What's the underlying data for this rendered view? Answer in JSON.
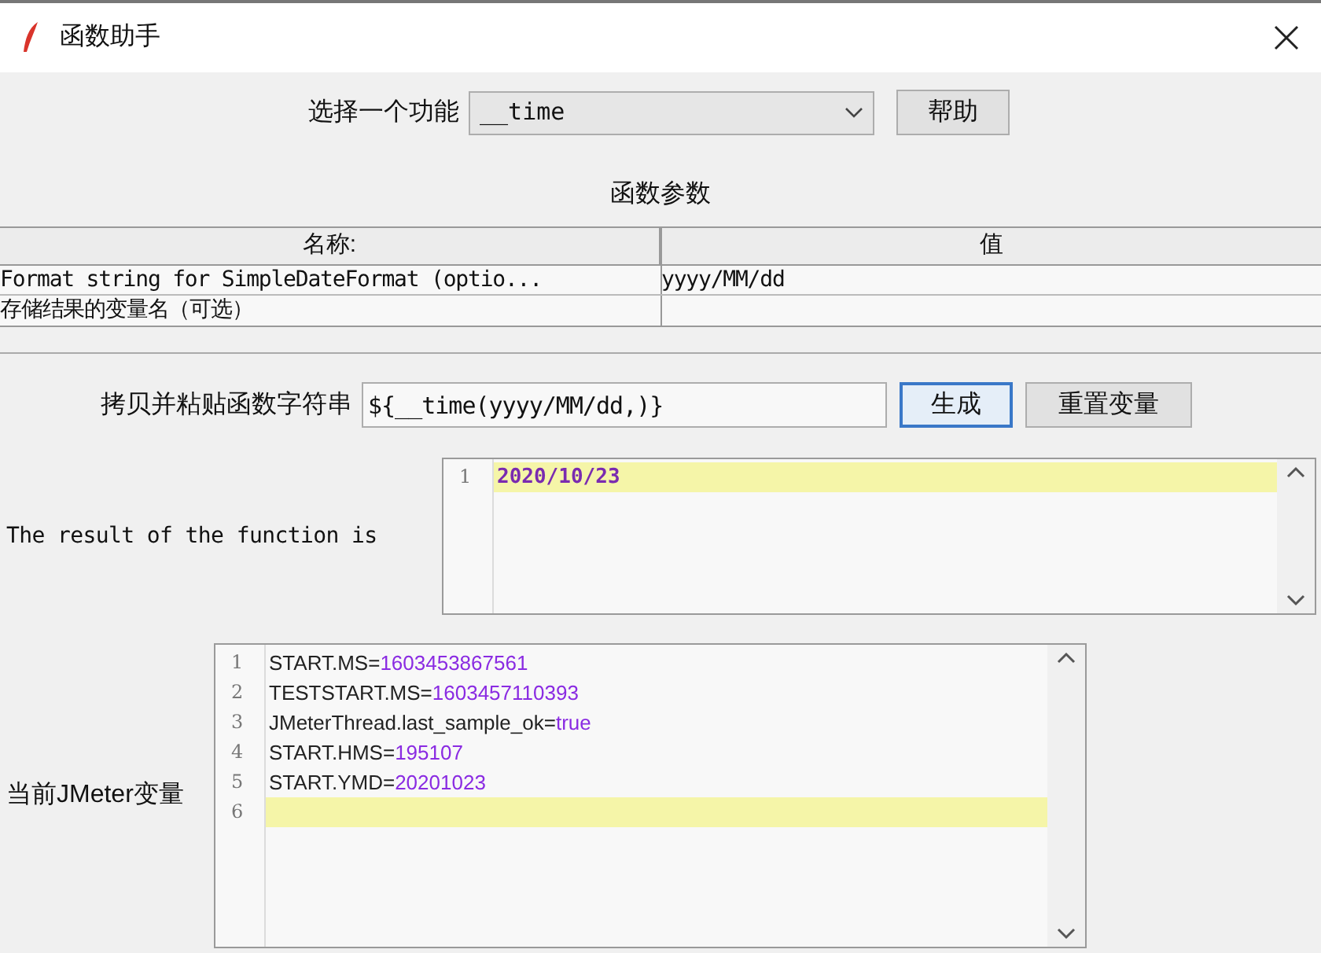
{
  "window": {
    "title": "函数助手"
  },
  "function_select": {
    "label": "选择一个功能",
    "value": "__time"
  },
  "help_button": "帮助",
  "params_title": "函数参数",
  "table": {
    "columns": [
      "名称:",
      "值"
    ],
    "rows": [
      [
        "Format string for SimpleDateFormat (optio...",
        "yyyy/MM/dd"
      ],
      [
        "存储结果的变量名（可选）",
        ""
      ]
    ]
  },
  "copy_field": {
    "label": "拷贝并粘贴函数字符串",
    "value": "${__time(yyyy/MM/dd,)}"
  },
  "generate_button": {
    "label": "生成",
    "focused": true
  },
  "reset_button": {
    "label": "重置变量",
    "focused": false
  },
  "result": {
    "label": "The result of the function is",
    "lines": [
      {
        "number": "1",
        "key": "2020/10/23",
        "current": true
      }
    ]
  },
  "variables": {
    "label": "当前JMeter变量",
    "lines": [
      {
        "number": "1",
        "key": "START.MS=",
        "value": "1603453867561",
        "current": false
      },
      {
        "number": "2",
        "key": "TESTSTART.MS=",
        "value": "1603457110393",
        "current": false
      },
      {
        "number": "3",
        "key": "JMeterThread.last_sample_ok=",
        "value": "true",
        "current": false
      },
      {
        "number": "4",
        "key": "START.HMS=",
        "value": "195107",
        "current": false
      },
      {
        "number": "5",
        "key": "START.YMD=",
        "value": "20201023",
        "current": false
      },
      {
        "number": "6",
        "current": true
      }
    ]
  }
}
